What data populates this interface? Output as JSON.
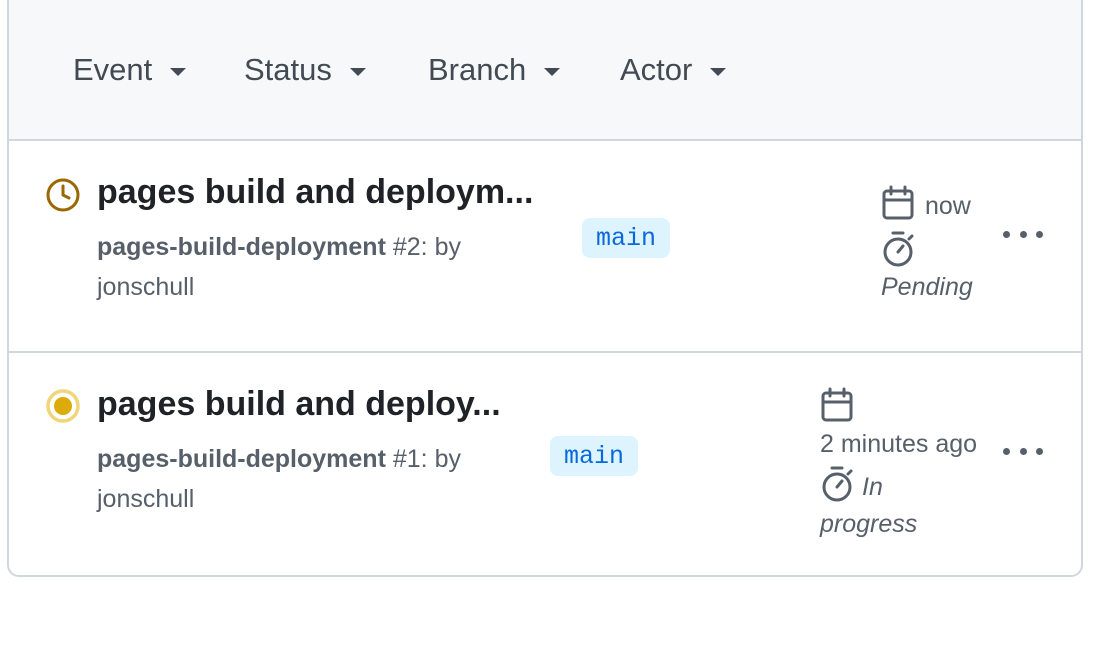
{
  "filters": {
    "event": "Event",
    "status": "Status",
    "branch": "Branch",
    "actor": "Actor"
  },
  "runs": [
    {
      "title": "pages build and deploym...",
      "workflow": "pages-build-deployment",
      "run_number": "#2",
      "by_text": ": by",
      "actor": "jonschull",
      "branch": "main",
      "time": "now",
      "duration": "Pending",
      "status_icon": "clock-icon",
      "status_color": "#9a6700"
    },
    {
      "title": "pages build and deploy...",
      "workflow": "pages-build-deployment",
      "run_number": "#1",
      "by_text": ": by",
      "actor": "jonschull",
      "branch": "main",
      "time": "2 minutes ago",
      "duration_1": "In",
      "duration_2": "progress",
      "status_icon": "in-progress-icon",
      "status_color": "#dbab0a"
    }
  ]
}
